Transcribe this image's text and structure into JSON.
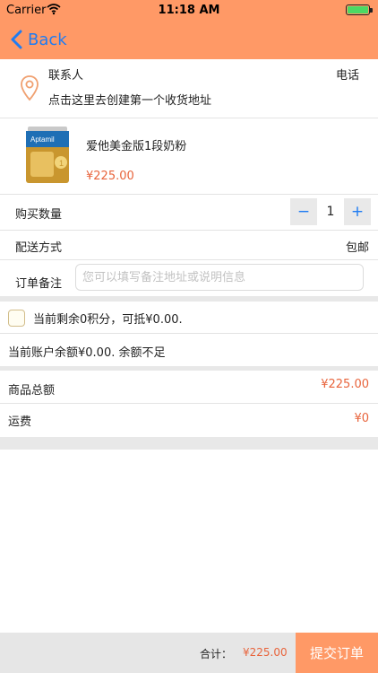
{
  "status_bar": {
    "carrier": "Carrier",
    "time": "11:18 AM"
  },
  "nav": {
    "back_label": "Back"
  },
  "address": {
    "contact_label": "联系人",
    "phone_label": "电话",
    "hint": "点击这里去创建第一个收货地址"
  },
  "product": {
    "name": "爱他美金版1段奶粉",
    "price": "¥225.00",
    "brand_text": "Aptamil"
  },
  "quantity": {
    "label": "购买数量",
    "value": "1",
    "minus": "−",
    "plus": "+"
  },
  "delivery": {
    "label": "配送方式",
    "value": "包邮"
  },
  "remark": {
    "label": "订单备注",
    "placeholder": "您可以填写备注地址或说明信息"
  },
  "points": {
    "text": "当前剩余0积分，可抵¥0.00."
  },
  "balance": {
    "text": "当前账户余额¥0.00. 余额不足"
  },
  "goods_total": {
    "label": "商品总额",
    "value": "¥225.00"
  },
  "shipping": {
    "label": "运费",
    "value": "¥0"
  },
  "footer": {
    "total_label": "合计：",
    "total_value": "¥225.00",
    "submit_label": "提交订单"
  },
  "colors": {
    "accent": "#ff9966",
    "link": "#1f7cf2",
    "price": "#e8643c"
  }
}
